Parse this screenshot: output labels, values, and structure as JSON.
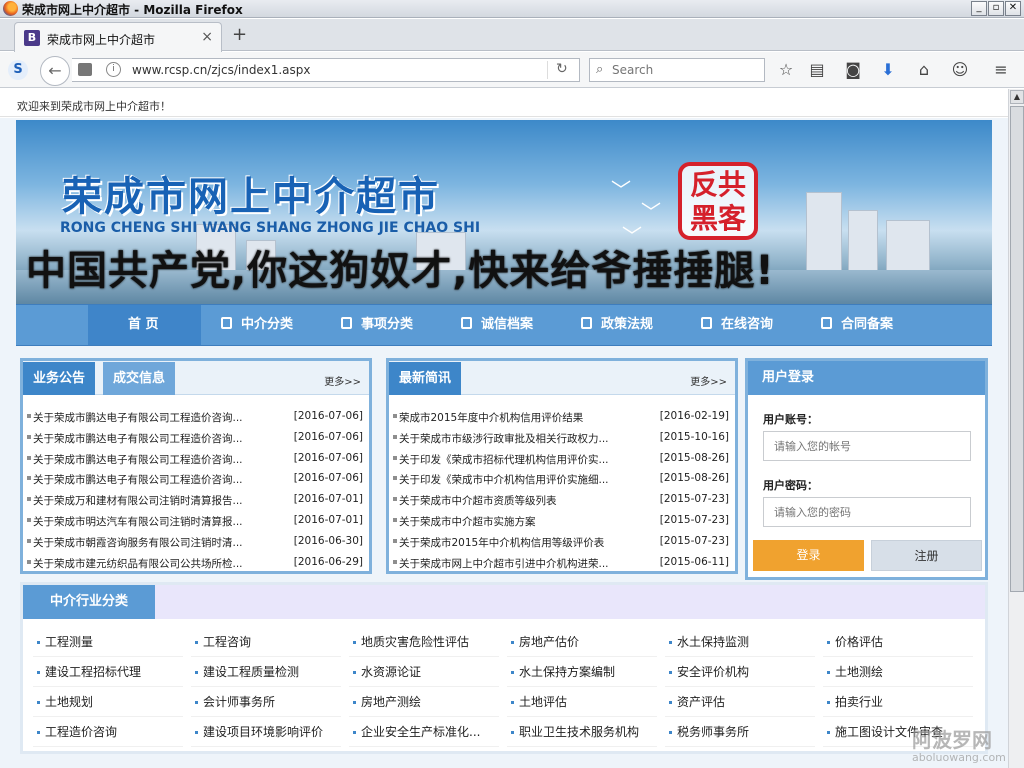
{
  "window": {
    "title": "荣成市网上中介超市 - Mozilla Firefox",
    "controls": [
      "_",
      "▫",
      "✕"
    ]
  },
  "browser": {
    "tab_title": "荣成市网上中介超市",
    "tab_favicon": "B",
    "url": "www.rcsp.cn/zjcs/index1.aspx",
    "search_placeholder": "Search",
    "toolbar_icons": [
      "star-icon",
      "reading-list-icon",
      "pocket-icon",
      "download-icon",
      "home-icon",
      "chat-icon",
      "menu-icon"
    ]
  },
  "infobar": {
    "welcome": "欢迎来到荣成市网上中介超市！"
  },
  "banner": {
    "title": "荣成市网上中介超市",
    "subtitle": "RONG CHENG SHI WANG SHANG ZHONG JIE CHAO SHI",
    "stamp_line1": "反共",
    "stamp_line2": "黑客",
    "graffiti": "中国共产党,你这狗奴才,快来给爷捶捶腿!"
  },
  "nav": {
    "home": "首 页",
    "items": [
      "中介分类",
      "事项分类",
      "诚信档案",
      "政策法规",
      "在线咨询",
      "合同备案"
    ]
  },
  "panel_left": {
    "tab_active": "业务公告",
    "tab_inactive": "成交信息",
    "more": "更多>>",
    "rows": [
      {
        "title": "关于荣成市鹏达电子有限公司工程造价咨询...",
        "date": "[2016-07-06]"
      },
      {
        "title": "关于荣成市鹏达电子有限公司工程造价咨询...",
        "date": "[2016-07-06]"
      },
      {
        "title": "关于荣成市鹏达电子有限公司工程造价咨询...",
        "date": "[2016-07-06]"
      },
      {
        "title": "关于荣成市鹏达电子有限公司工程造价咨询...",
        "date": "[2016-07-06]"
      },
      {
        "title": "关于荣成万和建材有限公司注销时清算报告...",
        "date": "[2016-07-01]"
      },
      {
        "title": "关于荣成市明达汽车有限公司注销时清算报...",
        "date": "[2016-07-01]"
      },
      {
        "title": "关于荣成市朝霞咨询服务有限公司注销时清...",
        "date": "[2016-06-30]"
      },
      {
        "title": "关于荣成市建元纺织品有限公司公共场所检...",
        "date": "[2016-06-29]"
      }
    ]
  },
  "panel_mid": {
    "tab_active": "最新简讯",
    "more": "更多>>",
    "rows": [
      {
        "title": "荣成市2015年度中介机构信用评价结果",
        "date": "[2016-02-19]"
      },
      {
        "title": "关于荣成市市级涉行政审批及相关行政权力...",
        "date": "[2015-10-16]"
      },
      {
        "title": "关于印发《荣成市招标代理机构信用评价实...",
        "date": "[2015-08-26]"
      },
      {
        "title": "关于印发《荣成市中介机构信用评价实施细...",
        "date": "[2015-08-26]"
      },
      {
        "title": "关于荣成市中介超市资质等级列表",
        "date": "[2015-07-23]"
      },
      {
        "title": "关于荣成市中介超市实施方案",
        "date": "[2015-07-23]"
      },
      {
        "title": "关于荣成市2015年中介机构信用等级评价表",
        "date": "[2015-07-23]"
      },
      {
        "title": "关于荣成市网上中介超市引进中介机构进荣...",
        "date": "[2015-06-11]"
      }
    ]
  },
  "login": {
    "header": "用户登录",
    "account_label": "用户账号：",
    "account_placeholder": "请输入您的帐号",
    "password_label": "用户密码：",
    "password_placeholder": "请输入您的密码",
    "login_button": "登录",
    "register_button": "注册"
  },
  "categories": {
    "header": "中介行业分类",
    "items": [
      "工程测量",
      "工程咨询",
      "地质灾害危险性评估",
      "房地产估价",
      "水土保持监测",
      "价格评估",
      "建设工程招标代理",
      "建设工程质量检测",
      "水资源论证",
      "水土保持方案编制",
      "安全评价机构",
      "土地测绘",
      "土地规划",
      "会计师事务所",
      "房地产测绘",
      "土地评估",
      "资产评估",
      "拍卖行业",
      "工程造价咨询",
      "建设项目环境影响评价",
      "企业安全生产标准化...",
      "职业卫生技术服务机构",
      "税务师事务所",
      "施工图设计文件审查"
    ]
  },
  "watermark": {
    "main": "阿波罗网",
    "sub": "aboluowang.com"
  },
  "colors": {
    "nav_blue": "#5b9bd5",
    "tab_blue": "#3d86c9",
    "login_orange": "#f0a22f",
    "stamp_red": "#d5212b"
  }
}
